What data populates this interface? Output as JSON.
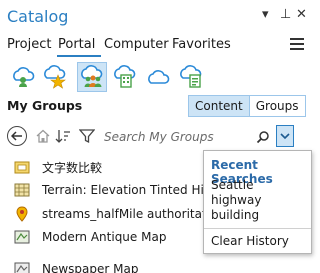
{
  "pane": {
    "title": "Catalog",
    "controls": [
      "▾",
      "⊥",
      "✕"
    ]
  },
  "tabs": [
    {
      "label": "Project"
    },
    {
      "label": "Portal",
      "active": true
    },
    {
      "label": "Computer"
    },
    {
      "label": "Favorites"
    }
  ],
  "portal_icons": [
    {
      "icon": "my-content-cloud-icon"
    },
    {
      "icon": "favorites-cloud-icon"
    },
    {
      "icon": "groups-cloud-icon",
      "selected": true
    },
    {
      "icon": "organization-cloud-icon"
    },
    {
      "icon": "arcgis-online-cloud-icon"
    },
    {
      "icon": "living-atlas-cloud-icon"
    }
  ],
  "section": {
    "title": "My Groups",
    "toggle": {
      "content": "Content",
      "groups": "Groups",
      "selected": "Content"
    }
  },
  "search": {
    "placeholder": "Search My Groups",
    "value": ""
  },
  "items": [
    {
      "label": "文字数比較",
      "icon": "map-package-icon"
    },
    {
      "label": "Terrain: Elevation Tinted Hillshade",
      "icon": "tile-layer-icon"
    },
    {
      "label": "streams_halfMile authoritative",
      "icon": "feature-layer-icon"
    },
    {
      "label": "Modern Antique Map",
      "icon": "web-map-icon"
    },
    {
      "label": "Newspaper Map",
      "icon": "web-map-icon"
    }
  ],
  "recent_searches": {
    "header": "Recent Searches",
    "entries": [
      "Seattle",
      "highway",
      "building"
    ],
    "clear": "Clear History"
  },
  "colors": {
    "accent": "#2b7fc2",
    "selected_bg": "#cde4f6",
    "header_blue": "#2b6aa8"
  }
}
